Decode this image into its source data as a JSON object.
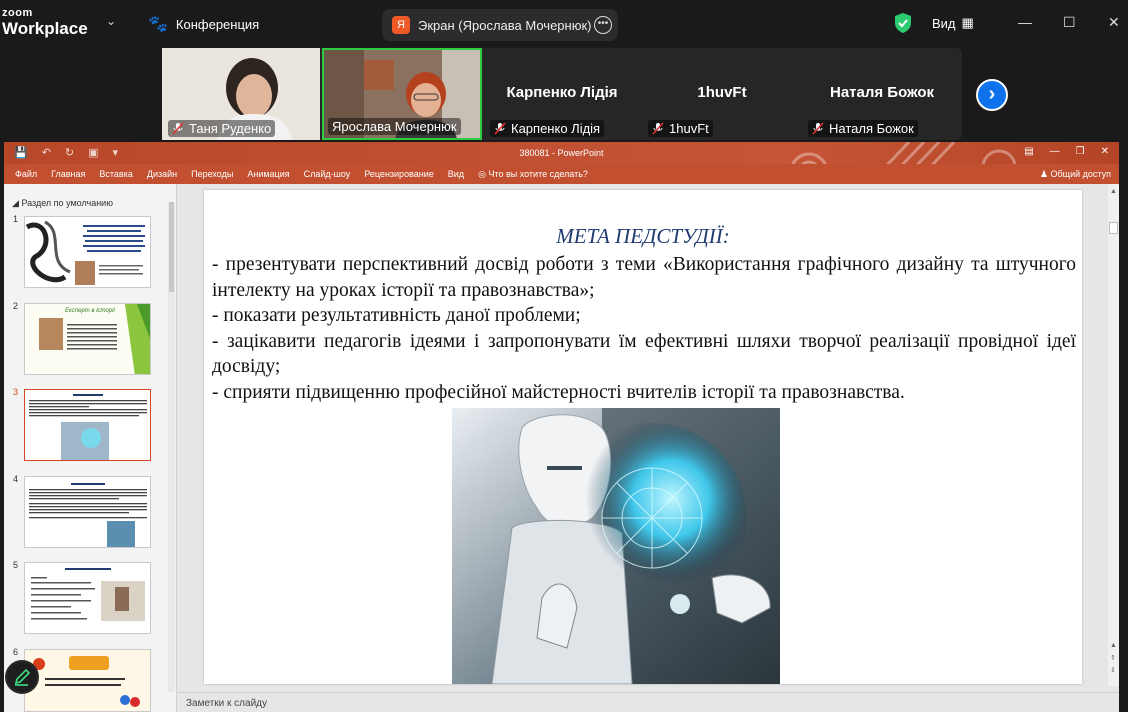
{
  "zoom": {
    "logo_line1": "zoom",
    "logo_line2": "Workplace",
    "meeting_label": "Конференция",
    "share_pill_letter": "Я",
    "share_pill_text": "Экран (Ярослава Мочернюк)",
    "view_label": "Вид",
    "participants": [
      {
        "name": "Таня Руденко",
        "muted": true,
        "has_video": true
      },
      {
        "name": "Ярослава Мочернюк",
        "muted": false,
        "has_video": true,
        "active_speaker": true
      },
      {
        "name": "Карпенко Лідія",
        "muted": true,
        "has_video": false
      },
      {
        "name": "1huvFt",
        "muted": true,
        "has_video": false
      },
      {
        "name": "Наталя Божок",
        "muted": true,
        "has_video": false
      }
    ],
    "next_icon": "chevron-right-icon",
    "accent": "#0e72ed",
    "shield_color": "#2ecc71"
  },
  "ppt": {
    "window_title": "380081 - PowerPoint",
    "tabs": [
      "Файл",
      "Главная",
      "Вставка",
      "Дизайн",
      "Переходы",
      "Анимация",
      "Слайд-шоу",
      "Рецензирование",
      "Вид"
    ],
    "tell_me": "Что вы хотите сделать?",
    "share": "Общий доступ",
    "section": "Раздел по умолчанию",
    "slide_numbers": [
      "1",
      "2",
      "3",
      "4",
      "5",
      "6"
    ],
    "selected_slide": 3,
    "notes_label": "Заметки к слайду",
    "accent": "#c24f30",
    "thumbs": {
      "s2_title": "Експерт в історіі"
    }
  },
  "slide": {
    "title": "МЕТА ПЕДСТУДІЇ:",
    "paragraphs": [
      " - презентувати перспективний досвід роботи з теми «Використання графічного дизайну та штучного інтелекту на уроках історії та правознавства»;",
      " - показати результативність даної проблеми;",
      " - зацікавити педагогів ідеями і запропонувати їм ефективні шляхи творчої реалізації провідної ідеї досвіду;",
      " - сприяти підвищенню професійної майстерності вчителів історії та правознавства."
    ]
  }
}
